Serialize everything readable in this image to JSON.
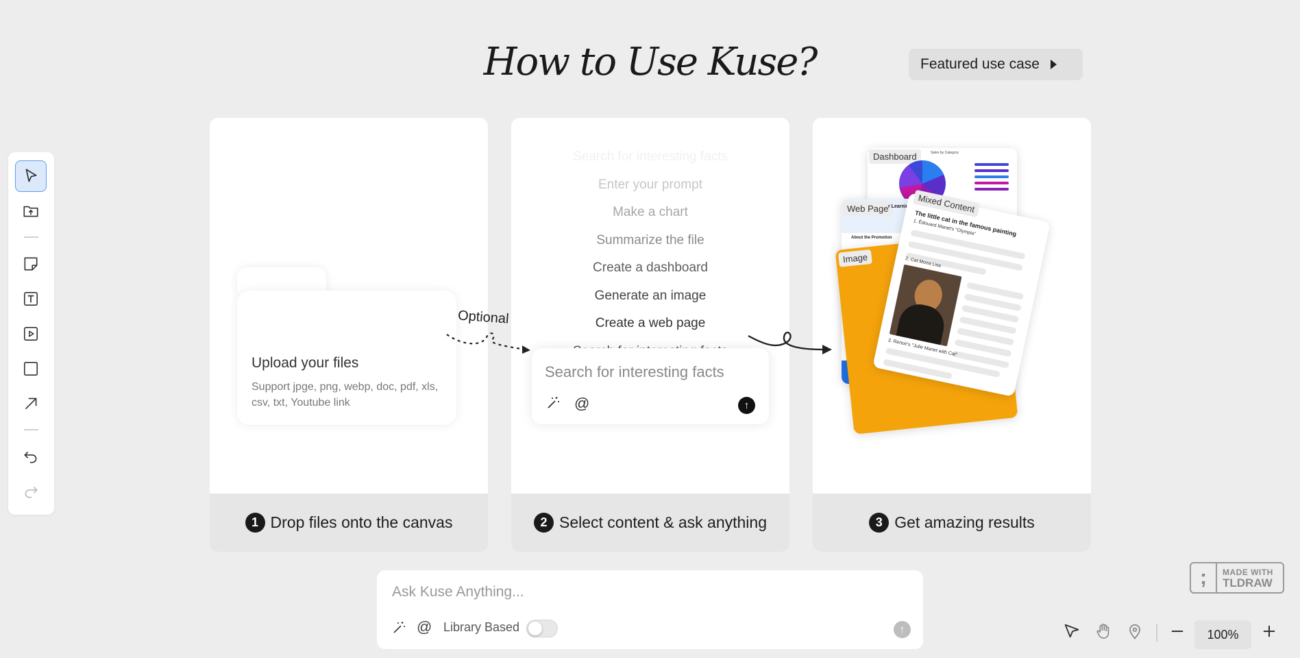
{
  "header": {
    "title": "How to Use Kuse?",
    "featured_label": "Featured use case"
  },
  "toolbar": {
    "tools": [
      "select-tool",
      "upload-tool",
      "note-tool",
      "text-tool",
      "video-tool",
      "rectangle-tool",
      "arrow-tool",
      "undo-tool",
      "redo-tool"
    ]
  },
  "steps": [
    {
      "number": "1",
      "label": "Drop files onto the canvas"
    },
    {
      "number": "2",
      "label": "Select content & ask anything"
    },
    {
      "number": "3",
      "label": "Get amazing results"
    }
  ],
  "upload": {
    "heading": "Upload your files",
    "subtext": "Support jpge, png, webp, doc, pdf, xls, csv, txt, Youtube link"
  },
  "connector": {
    "optional_label": "Optional"
  },
  "prompts": [
    "Search for interesting facts",
    "Enter your prompt",
    "Make a chart",
    "Summarize the file",
    "Create a dashboard",
    "Generate an image",
    "Create a web page",
    "Search for interesting facts"
  ],
  "askbox": {
    "placeholder": "Search for interesting facts",
    "mention": "@"
  },
  "results": {
    "dashboard_tag": "Dashboard",
    "dashboard_title": "Sales by Category",
    "webpage_tag": "Web Page",
    "webpage_heading": "r Learning w",
    "webpage_sub": "About the Promotion",
    "image_tag": "Image",
    "mixed_tag": "Mixed Content",
    "mixed_title": "The little cat in the famous painting",
    "mixed_item1": "1. Édouard Manet's \"Olympia\"",
    "mixed_item2": "2. Cat Mona Lisa",
    "mixed_item3": "3. Renoir's \"Julie Manet with Cat\""
  },
  "bottom": {
    "placeholder": "Ask Kuse Anything...",
    "mention": "@",
    "library_label": "Library Based",
    "library_on": false
  },
  "branding": {
    "line1": "MADE WITH",
    "line2": "TLDRAW"
  },
  "navigation": {
    "zoom": "100%"
  },
  "colors": {
    "accent_blue": "#5b9cf0",
    "orange": "#f4a30b",
    "background": "#ededed"
  }
}
